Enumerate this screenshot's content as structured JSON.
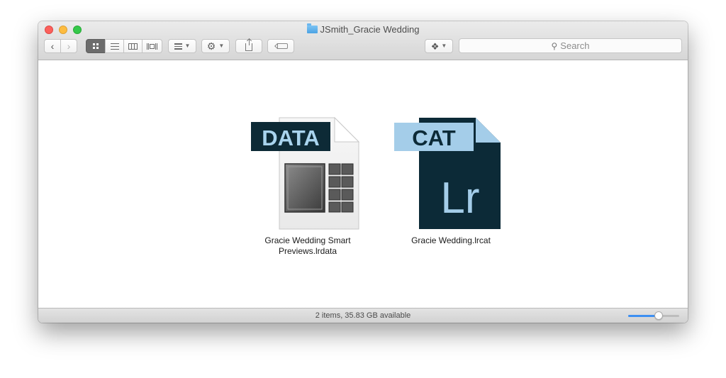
{
  "window": {
    "title": "JSmith_Gracie Wedding"
  },
  "toolbar": {
    "search_placeholder": "Search",
    "view_modes": [
      "icon",
      "list",
      "column",
      "cover-flow"
    ],
    "active_view": "icon"
  },
  "files": [
    {
      "label_line1": "Gracie Wedding Smart",
      "label_line2": "Previews.lrdata",
      "badge": "DATA",
      "icon": "lrdata-file-icon"
    },
    {
      "label_line1": "Gracie Wedding.lrcat",
      "label_line2": "",
      "badge": "CAT",
      "logo": "Lr",
      "icon": "lrcat-file-icon"
    }
  ],
  "status": {
    "text": "2 items, 35.83 GB available",
    "icon_size_fraction": 0.6
  },
  "colors": {
    "close": "#fc605c",
    "minimize": "#fdbc40",
    "maximize": "#34c84a",
    "lightroom_dark": "#0c2a37",
    "lightroom_accent": "#a4cde9",
    "slider_accent": "#3d8ff2"
  }
}
